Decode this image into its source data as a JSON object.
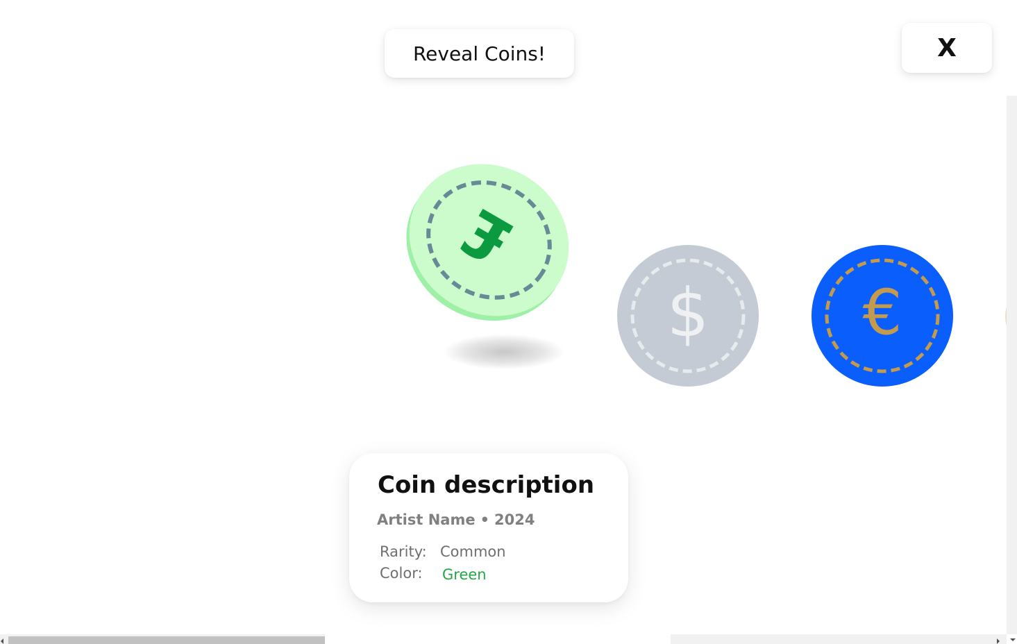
{
  "reveal_button": {
    "label": "Reveal Coins!"
  },
  "close_button": {
    "label": "X"
  },
  "coins": [
    {
      "symbol": "£",
      "face_color": "#ccfbcc",
      "edge_color": "#9ef0a6",
      "ring_color": "#678a96",
      "symbol_color": "#0b9a3f"
    },
    {
      "symbol": "$",
      "face_color": "#c4cbd4",
      "ring_color": "#e8ebee",
      "symbol_color": "#eef0f2"
    },
    {
      "symbol": "€",
      "face_color": "#0a5efc",
      "ring_color": "#c49a4c",
      "symbol_color": "#c49a4c"
    }
  ],
  "card": {
    "title": "Coin description",
    "artist": "Artist Name",
    "separator": "•",
    "year": "2024",
    "rarity_label": "Rarity:",
    "rarity_value": "Common",
    "color_label": "Color:",
    "color_value": "Green",
    "color_value_color": "#22a845"
  }
}
